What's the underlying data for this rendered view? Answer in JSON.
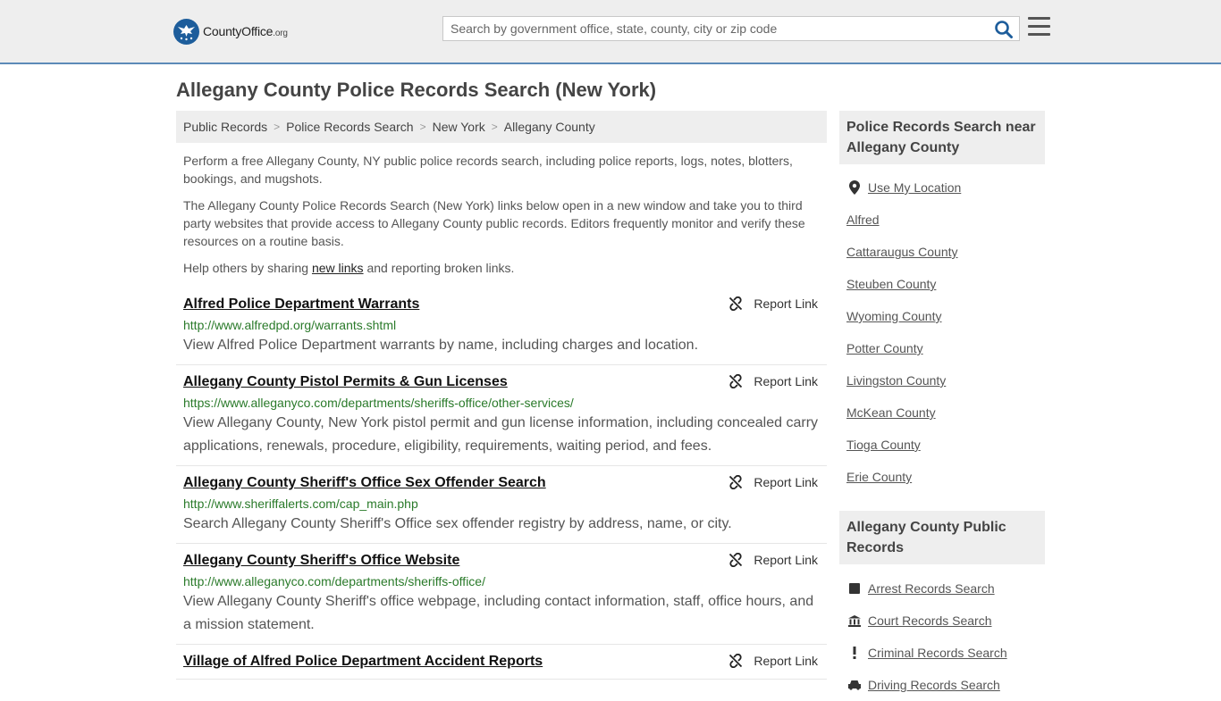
{
  "header": {
    "logo_main": "CountyOffice",
    "logo_domain": ".org",
    "search_placeholder": "Search by government office, state, county, city or zip code"
  },
  "page": {
    "title": "Allegany County Police Records Search (New York)"
  },
  "breadcrumb": [
    "Public Records",
    "Police Records Search",
    "New York",
    "Allegany County"
  ],
  "intro": {
    "p1": "Perform a free Allegany County, NY public police records search, including police reports, logs, notes, blotters, bookings, and mugshots.",
    "p2": "The Allegany County Police Records Search (New York) links below open in a new window and take you to third party websites that provide access to Allegany County public records. Editors frequently monitor and verify these resources on a routine basis.",
    "p3_before": "Help others by sharing ",
    "p3_link": "new links",
    "p3_after": " and reporting broken links."
  },
  "report_label": "Report Link",
  "results": [
    {
      "title": "Alfred Police Department Warrants",
      "url": "http://www.alfredpd.org/warrants.shtml",
      "desc": "View Alfred Police Department warrants by name, including charges and location."
    },
    {
      "title": "Allegany County Pistol Permits & Gun Licenses",
      "url": "https://www.alleganyco.com/departments/sheriffs-office/other-services/",
      "desc": "View Allegany County, New York pistol permit and gun license information, including concealed carry applications, renewals, procedure, eligibility, requirements, waiting period, and fees."
    },
    {
      "title": "Allegany County Sheriff's Office Sex Offender Search",
      "url": "http://www.sheriffalerts.com/cap_main.php",
      "desc": "Search Allegany County Sheriff's Office sex offender registry by address, name, or city."
    },
    {
      "title": "Allegany County Sheriff's Office Website",
      "url": "http://www.alleganyco.com/departments/sheriffs-office/",
      "desc": "View Allegany County Sheriff's office webpage, including contact information, staff, office hours, and a mission statement."
    },
    {
      "title": "Village of Alfred Police Department Accident Reports",
      "url": "",
      "desc": ""
    }
  ],
  "sidebar": {
    "nearby_heading": "Police Records Search near Allegany County",
    "use_location": "Use My Location",
    "nearby": [
      "Alfred",
      "Cattaraugus County",
      "Steuben County",
      "Wyoming County",
      "Potter County",
      "Livingston County",
      "McKean County",
      "Tioga County",
      "Erie County"
    ],
    "records_heading": "Allegany County Public Records",
    "records": [
      {
        "label": "Arrest Records Search",
        "icon": "square-icon"
      },
      {
        "label": "Court Records Search",
        "icon": "courthouse-icon"
      },
      {
        "label": "Criminal Records Search",
        "icon": "exclamation-icon"
      },
      {
        "label": "Driving Records Search",
        "icon": "car-icon"
      }
    ]
  },
  "colors": {
    "header_bg": "#eeeeee",
    "accent_border": "#5c8ab8",
    "logo_blue": "#1d5d9b",
    "url_green": "#2a7a2a"
  }
}
